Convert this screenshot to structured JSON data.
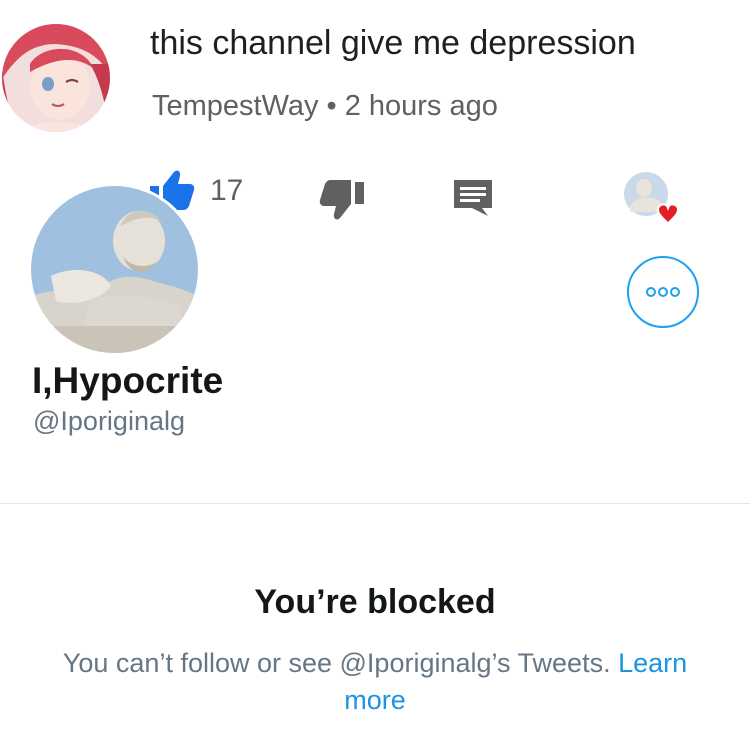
{
  "youtube_comment": {
    "text": "this channel give me depression",
    "author": "TempestWay",
    "separator": "•",
    "time_ago": "2 hours ago",
    "like_count": "17",
    "icons": [
      "anime-avatar-icon",
      "thumbs-up-icon",
      "thumbs-down-icon",
      "reply-icon",
      "creator-heart-icon"
    ],
    "colors": {
      "like_blue": "#1a73e8",
      "gray": "#606060",
      "heart_red": "#e41e25"
    }
  },
  "twitter_profile": {
    "display_name": "I,Hypocrite",
    "handle": "@Iporiginalg",
    "blocked_title": "You’re blocked",
    "blocked_message": "You can’t follow or see @Iporiginalg’s Tweets.",
    "learn_more": "Learn more",
    "icons": [
      "statue-avatar-icon",
      "more-options-icon"
    ],
    "colors": {
      "twitter_blue": "#1da1f2",
      "link_blue": "#1b95e0",
      "secondary_text": "#657786"
    }
  }
}
